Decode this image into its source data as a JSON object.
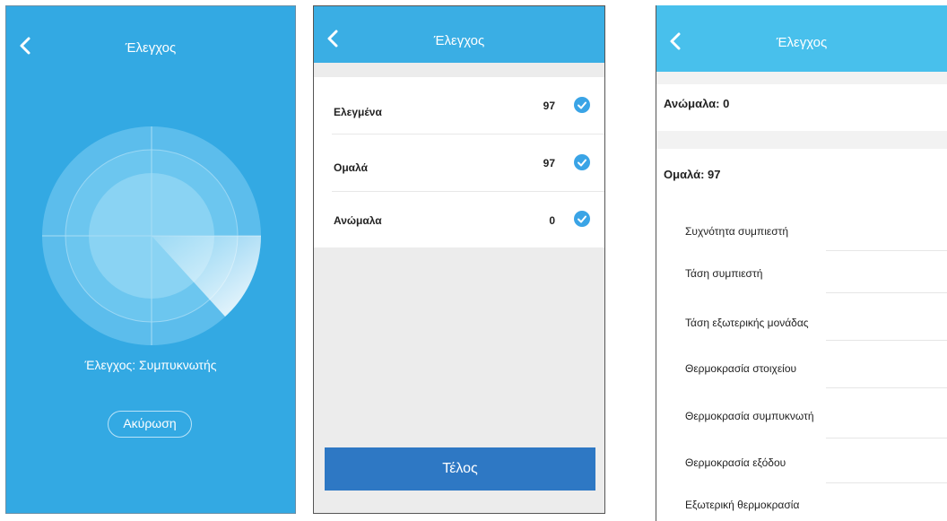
{
  "screen1": {
    "title": "Έλεγχος",
    "status_text": "Έλεγχος: Συμπυκνωτής",
    "cancel_label": "Ακύρωση"
  },
  "screen2": {
    "title": "Έλεγχος",
    "rows": [
      {
        "label": "Ελεγμένα",
        "value": "97"
      },
      {
        "label": "Ομαλά",
        "value": "97"
      },
      {
        "label": "Ανώμαλα",
        "value": "0"
      }
    ],
    "done_label": "Τέλος"
  },
  "screen3": {
    "title": "Έλεγχος",
    "abnormal_label": "Ανώμαλα: 0",
    "normal_label": "Ομαλά: 97",
    "items": [
      "Συχνότητα συμπιεστή",
      "Τάση συμπιεστή",
      "Τάση εξωτερικής μονάδας",
      "Θερμοκρασία στοιχείου",
      "Θερμοκρασία συμπυκνωτή",
      "Θερμοκρασία εξόδου",
      "Εξωτερική θερμοκρασία"
    ]
  },
  "colors": {
    "screen1_bg": "#33a9e3",
    "header_blue": "#3aaee4",
    "done_button": "#2e78c4",
    "check_blue": "#3aa4e6"
  },
  "icons": [
    "back-chevron-icon",
    "radar-scanner",
    "check-circle-icon"
  ]
}
